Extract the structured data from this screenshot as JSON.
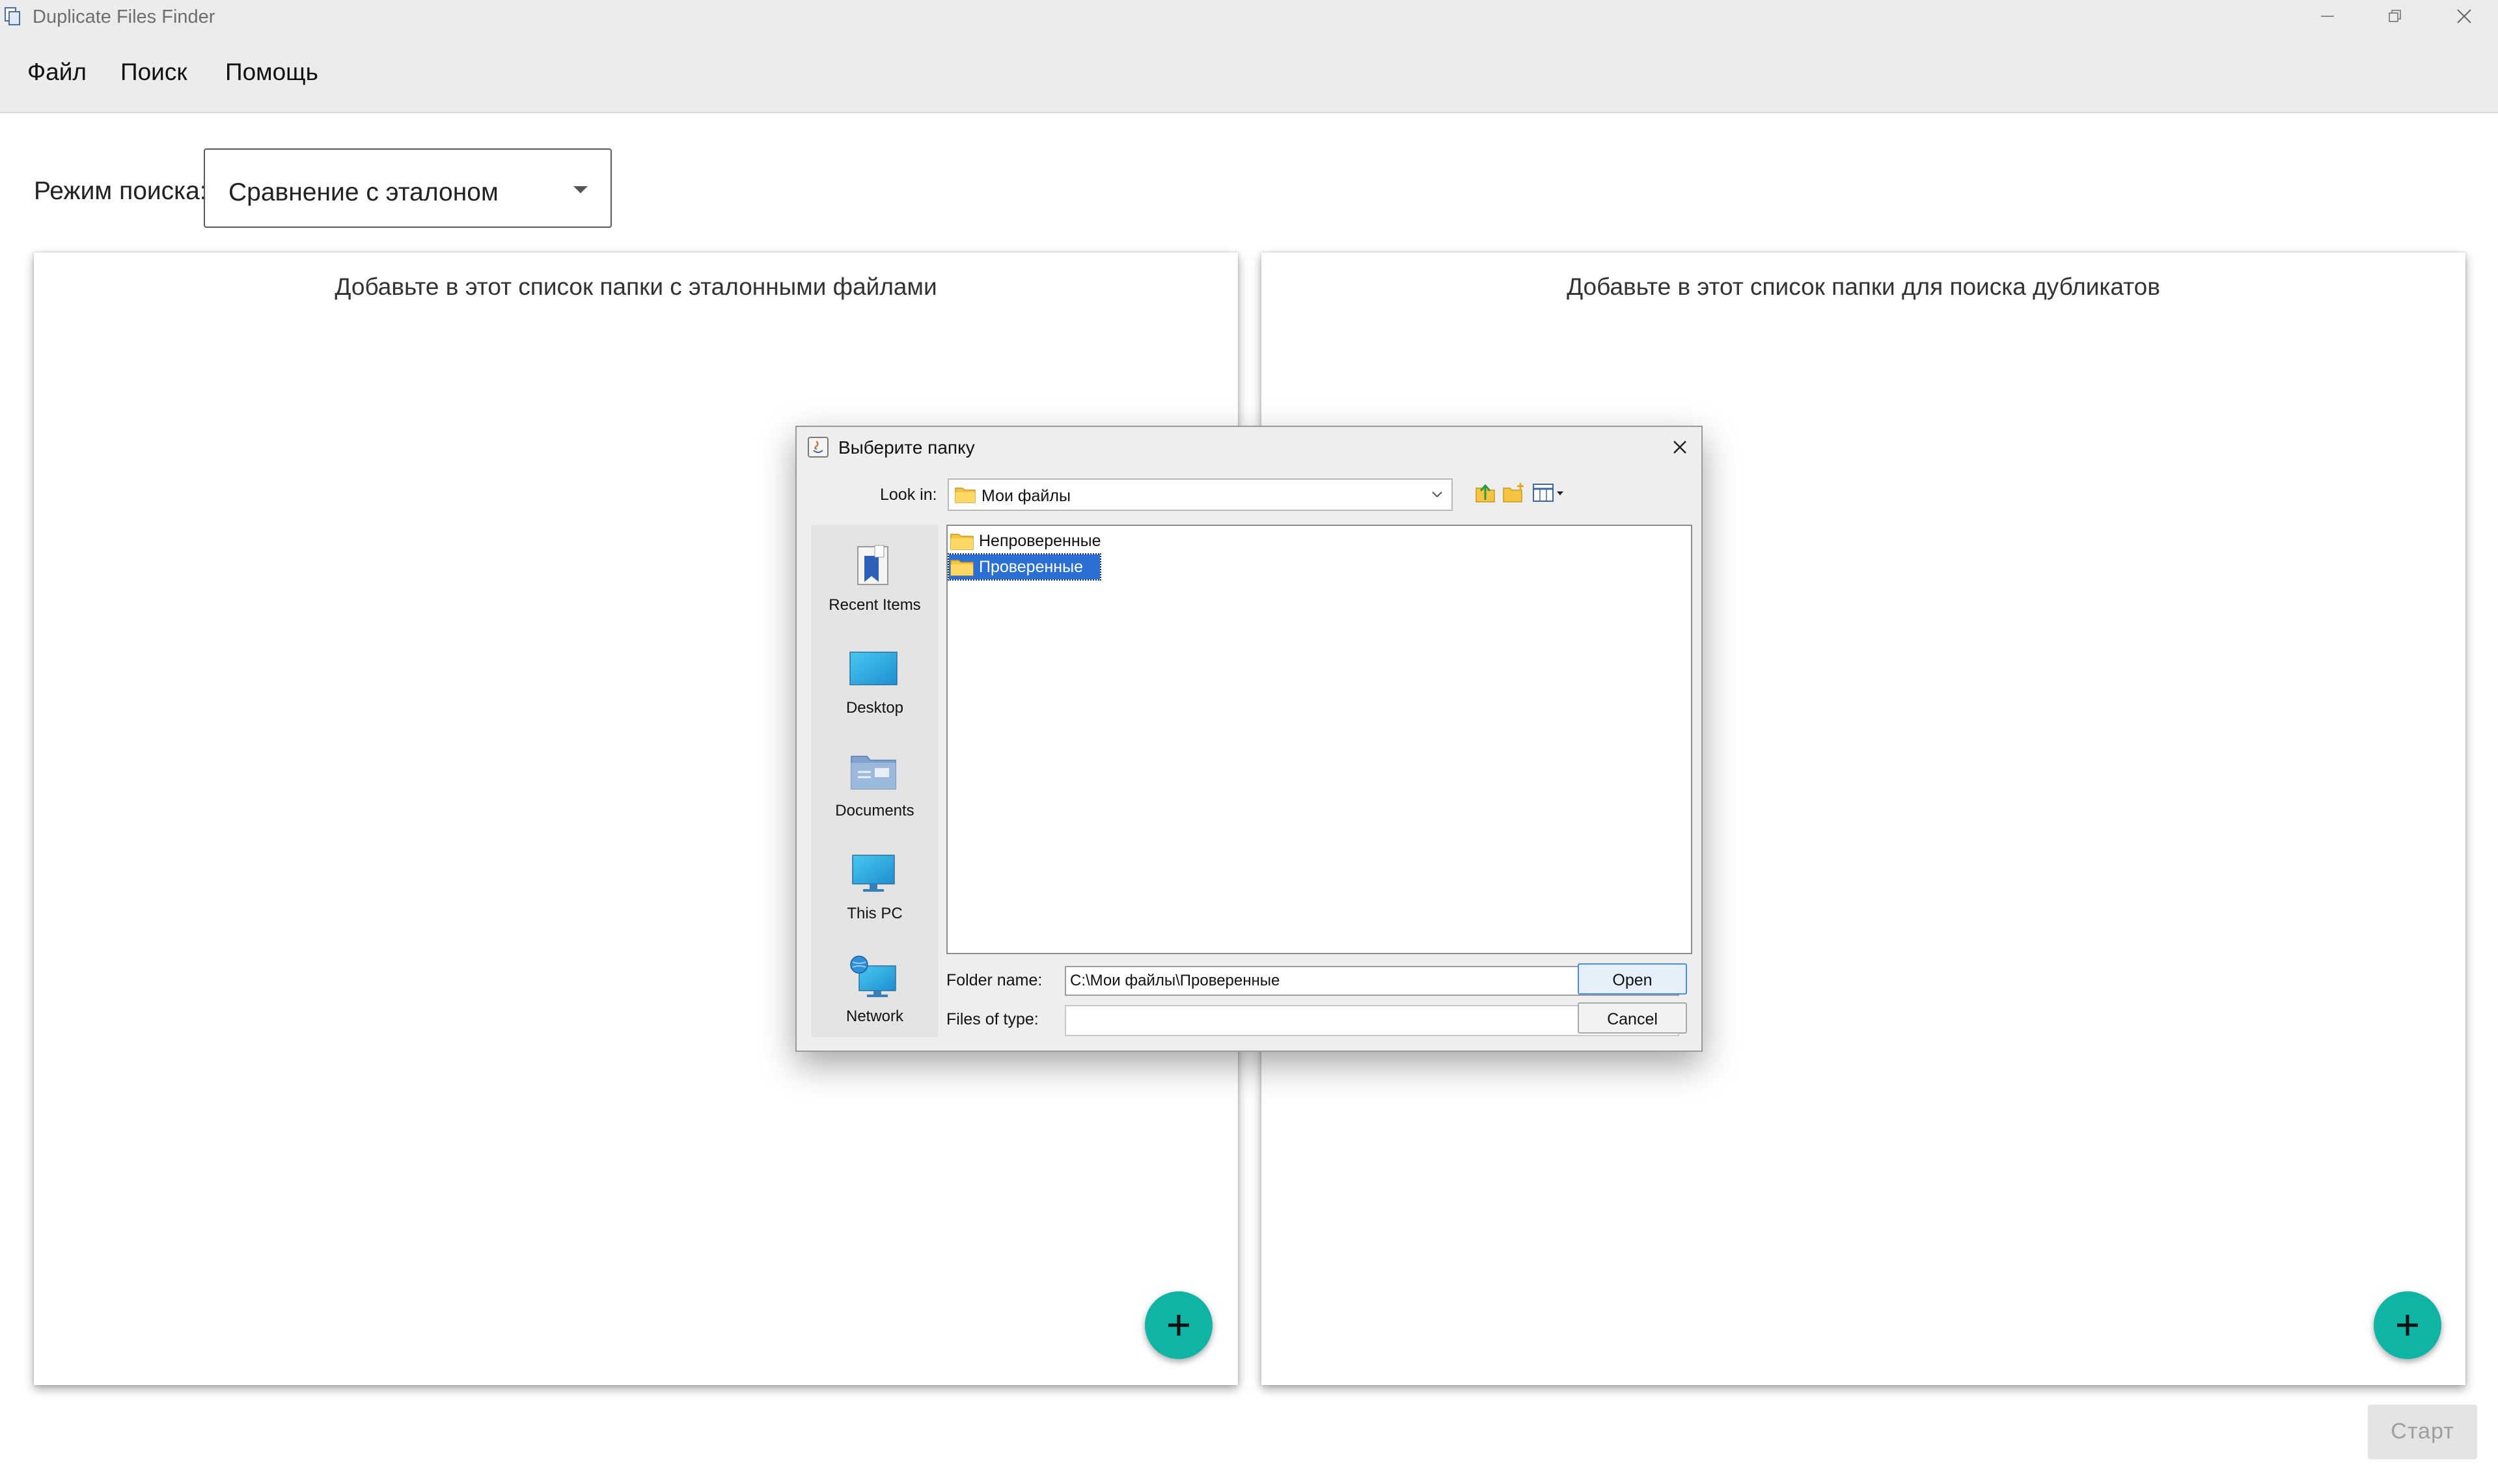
{
  "window": {
    "title": "Duplicate Files Finder"
  },
  "menu": {
    "items": [
      "Файл",
      "Поиск",
      "Помощь"
    ]
  },
  "search_mode": {
    "label": "Режим поиска:",
    "selected": "Сравнение с эталоном"
  },
  "panels": {
    "left_title": "Добавьте в этот список папки с эталонными файлами",
    "right_title": "Добавьте в этот список папки для поиска дубликатов"
  },
  "start_button": {
    "label": "Старт",
    "enabled": false
  },
  "colors": {
    "fab": "#0fb4a4",
    "selection": "#2a6fd4",
    "chrome": "#ececec"
  },
  "dialog": {
    "title": "Выберите папку",
    "look_in_label": "Look in:",
    "look_in_value": "Мои файлы",
    "places": [
      "Recent Items",
      "Desktop",
      "Documents",
      "This PC",
      "Network"
    ],
    "files": [
      {
        "name": "Непроверенные",
        "selected": false
      },
      {
        "name": "Проверенные",
        "selected": true
      }
    ],
    "folder_name_label": "Folder name:",
    "folder_name_value": "C:\\Мои файлы\\Проверенные",
    "files_of_type_label": "Files of type:",
    "files_of_type_value": "",
    "open_label": "Open",
    "cancel_label": "Cancel"
  }
}
